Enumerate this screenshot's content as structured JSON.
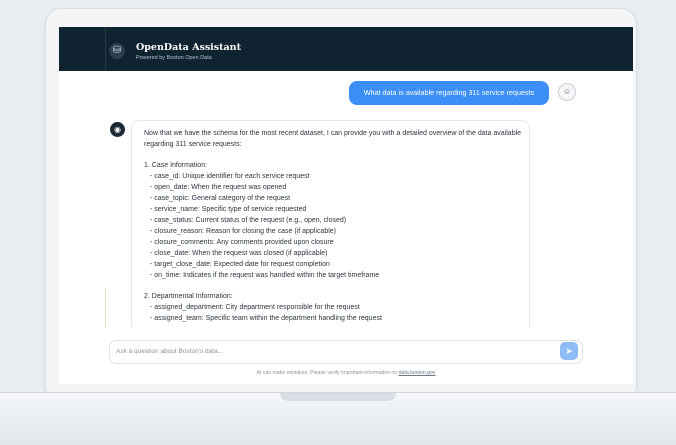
{
  "app": {
    "title": "OpenData Assistant",
    "subtitle": "Powered by Boston Open Data",
    "logo_icon": "database-icon",
    "accent_color": "#3b8ff6",
    "header_color": "#102331"
  },
  "chat": {
    "user_message": "What data is available regarding 311 service requests",
    "user_avatar_icon": "user-icon",
    "bot_avatar_icon": "bot-icon",
    "assistant": {
      "intro": "Now that we have the schema for the most recent dataset, I can provide you with a detailed overview of the data available regarding 311 service requests:",
      "section1_title": "1. Case Information:",
      "section1_items": [
        "- case_id: Unique identifier for each service request",
        "- open_date: When the request was opened",
        "- case_topic: General category of the request",
        "- service_name: Specific type of service requested",
        "- case_status: Current status of the request (e.g., open, closed)",
        "- closure_reason: Reason for closing the case (if applicable)",
        "- closure_comments: Any comments provided upon closure",
        "- close_date: When the request was closed (if applicable)",
        "- target_close_date: Expected date for request completion",
        "- on_time: Indicates if the request was handled within the target timeframe"
      ],
      "section2_title": "2. Departmental Information:",
      "section2_items": [
        "- assigned_department: City department responsible for the request",
        "- assigned_team: Specific team within the department handling the request"
      ]
    }
  },
  "input": {
    "placeholder": "Ask a question about Boston's data...",
    "send_icon": "send-icon"
  },
  "footer": {
    "disclaimer_text": "AI can make mistakes. Please verify important information on",
    "disclaimer_link": "data.boston.gov"
  }
}
